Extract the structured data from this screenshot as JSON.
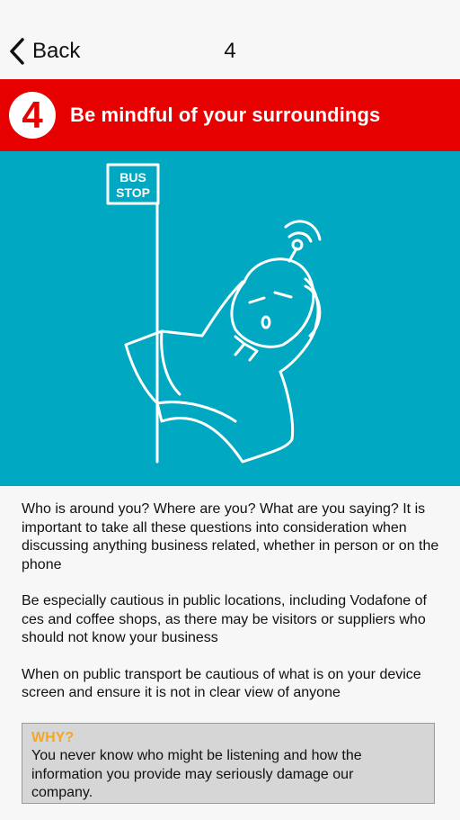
{
  "nav": {
    "back_label": "Back",
    "page_number": "4"
  },
  "banner": {
    "step_number": "4",
    "title": "Be mindful of your surroundings",
    "color": "#e60000"
  },
  "illustration": {
    "background_color": "#00a8c1",
    "sign_text_line1": "BUS",
    "sign_text_line2": "STOP"
  },
  "content": {
    "paragraph1": "Who is around you? Where are you? What are you saying? It is important to take all these questions into consideration when discussing anything business related, whether in person or on the phone",
    "paragraph2": "Be especially cautious in public locations, including Vodafone of ces and coffee shops, as there may be visitors or suppliers who should not know your business",
    "paragraph3": "When on public transport be cautious of what is on your device screen and ensure it is not in clear view of anyone"
  },
  "why": {
    "title": "WHY?",
    "title_color": "#f5a623",
    "text": "You never know who might be listening and how the information you provide may seriously damage our company."
  }
}
